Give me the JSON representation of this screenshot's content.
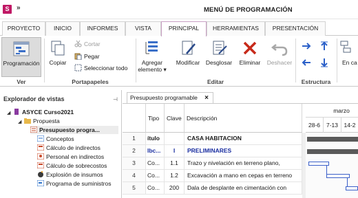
{
  "app": {
    "logo_letter": "S",
    "quick_access": "»",
    "title": "MENÚ DE PROGRAMACIÓN"
  },
  "tabs": [
    {
      "label": "PROYECTO"
    },
    {
      "label": "INICIO"
    },
    {
      "label": "INFORMES"
    },
    {
      "label": "VISTA"
    },
    {
      "label": "PRINCIPAL",
      "active": true
    },
    {
      "label": "HERRAMIENTAS"
    },
    {
      "label": "PRESENTACIÓN"
    }
  ],
  "ribbon": {
    "ver": {
      "group_label": "Ver",
      "programacion": "Programación"
    },
    "portapapeles": {
      "group_label": "Portapapeles",
      "copiar": "Copiar",
      "cortar": "Cortar",
      "pegar": "Pegar",
      "seleccionar_todo": "Seleccionar todo"
    },
    "editar": {
      "group_label": "Editar",
      "agregar_line1": "Agregar",
      "agregar_line2": "elemento ▾",
      "modificar": "Modificar",
      "desglosar": "Desglosar",
      "eliminar": "Eliminar",
      "deshacer": "Deshacer"
    },
    "estructura": {
      "group_label": "Estructura"
    },
    "en_cadena": "En ca"
  },
  "explorer": {
    "header": "Explorador de vistas",
    "pin": "⊣",
    "items": [
      {
        "label": "ASYCE Curso2021"
      },
      {
        "label": "Propuesta"
      },
      {
        "label": "Presupuesto progra..."
      },
      {
        "label": "Conceptos"
      },
      {
        "label": "Cálculo de indirectos"
      },
      {
        "label": "Personal en indirectos"
      },
      {
        "label": "Cálculo de sobrecostos"
      },
      {
        "label": "Explosión de insumos"
      },
      {
        "label": "Programa de suministros"
      }
    ]
  },
  "document": {
    "tab_label": "Presupuesto programable",
    "tab_close": "×",
    "columns": {
      "tipo": "Tipo",
      "clave": "Clave",
      "descripcion": "Descripción"
    },
    "gantt": {
      "month": "marzo",
      "weeks": [
        "28-6",
        "7-13",
        "14-2"
      ]
    },
    "rows": [
      {
        "num": "1",
        "tipo": "ítulo",
        "clave": "",
        "descripcion": "CASA HABITACION"
      },
      {
        "num": "2",
        "tipo": "Ibc...",
        "clave": "I",
        "descripcion": "PRELIMINARES"
      },
      {
        "num": "3",
        "tipo": "Co...",
        "clave": "1.1",
        "descripcion": "Trazo y nivelación en terreno plano,"
      },
      {
        "num": "4",
        "tipo": "Co...",
        "clave": "1.2",
        "descripcion": "Excavación a mano en cepas en terreno"
      },
      {
        "num": "5",
        "tipo": "Co...",
        "clave": "200",
        "descripcion": "Dala de desplante en cimentación con"
      }
    ]
  },
  "colors": {
    "brand": "#c01865",
    "active_tab_border": "#c9a0c4",
    "gantt_bar": "#3a5fc8",
    "summary_bar": "#5a5a5a",
    "preliminares_text": "#1a2ea0"
  }
}
